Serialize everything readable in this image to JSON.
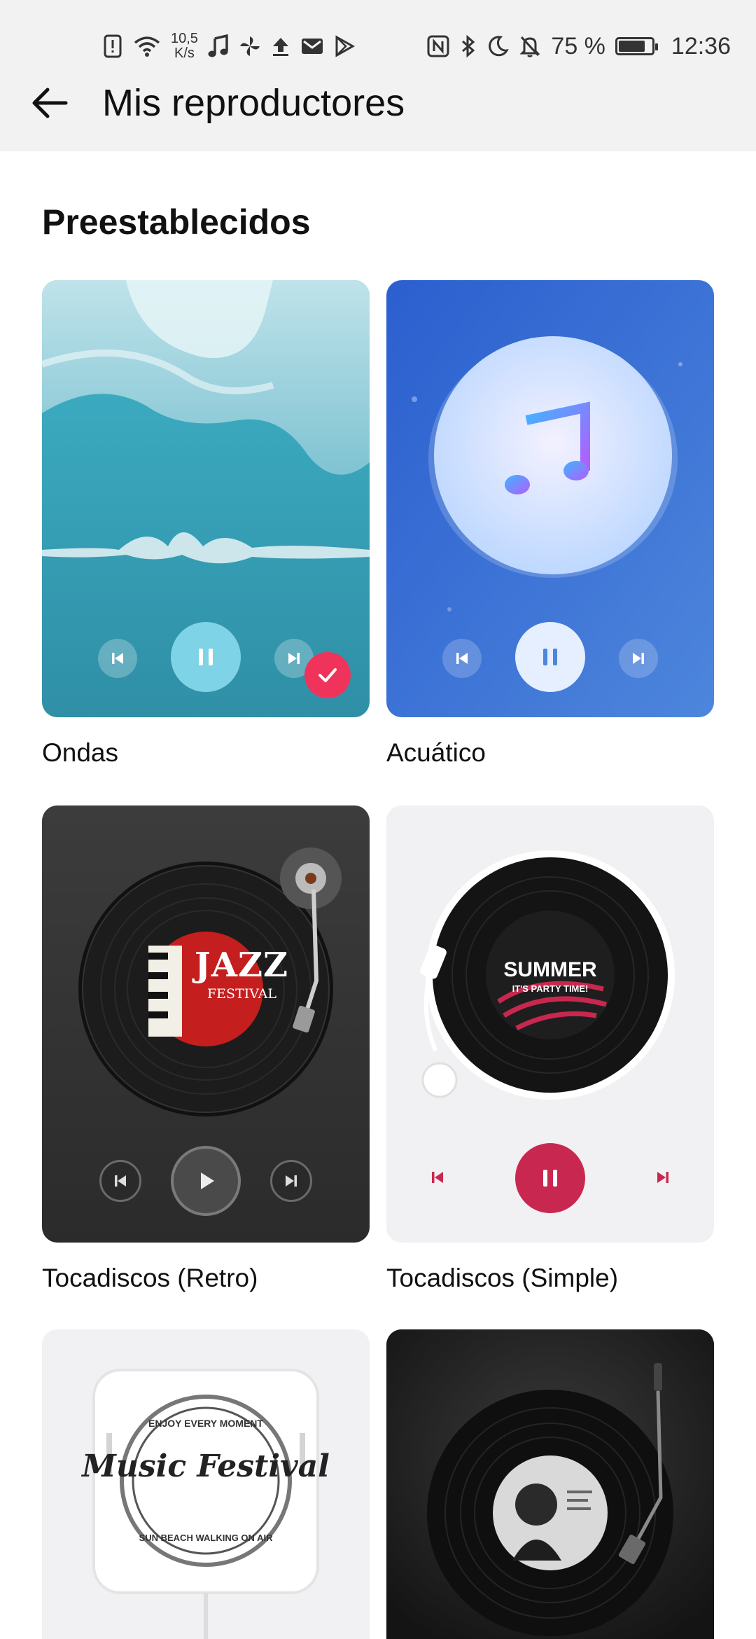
{
  "status_bar": {
    "net_speed_value": "10,5",
    "net_speed_unit": "K/s",
    "battery": "75 %",
    "time": "12:36",
    "icons": [
      "alert-icon",
      "wifi-icon",
      "music-note-icon",
      "pinwheel-icon",
      "upload-icon",
      "mail-icon",
      "play-store-icon",
      "nfc-icon",
      "bluetooth-icon",
      "moon-icon",
      "bell-off-icon",
      "battery-icon"
    ]
  },
  "header": {
    "title": "Mis reproductores",
    "back_icon": "back-arrow-icon"
  },
  "section": {
    "title": "Preestablecidos"
  },
  "players": [
    {
      "label": "Ondas",
      "selected": true,
      "state": "pause"
    },
    {
      "label": "Acuático",
      "selected": false,
      "state": "pause"
    },
    {
      "label": "Tocadiscos (Retro)",
      "selected": false,
      "state": "play",
      "art_text": "JAZZ",
      "art_subtext": "FESTIVAL"
    },
    {
      "label": "Tocadiscos (Simple)",
      "selected": false,
      "state": "pause",
      "art_text": "SUMMER",
      "art_subtext": "IT'S PARTY TIME!"
    },
    {
      "label": "",
      "selected": false,
      "art_text": "Music Festival",
      "art_subtext": "ENJOY EVERY MOMENT",
      "art_bottom": "SUN BEACH WALKING ON AIR"
    },
    {
      "label": "",
      "selected": false
    }
  ],
  "colors": {
    "accent": "#f0335a",
    "header_bg": "#f2f2f2",
    "simple_accent": "#c8284f"
  }
}
